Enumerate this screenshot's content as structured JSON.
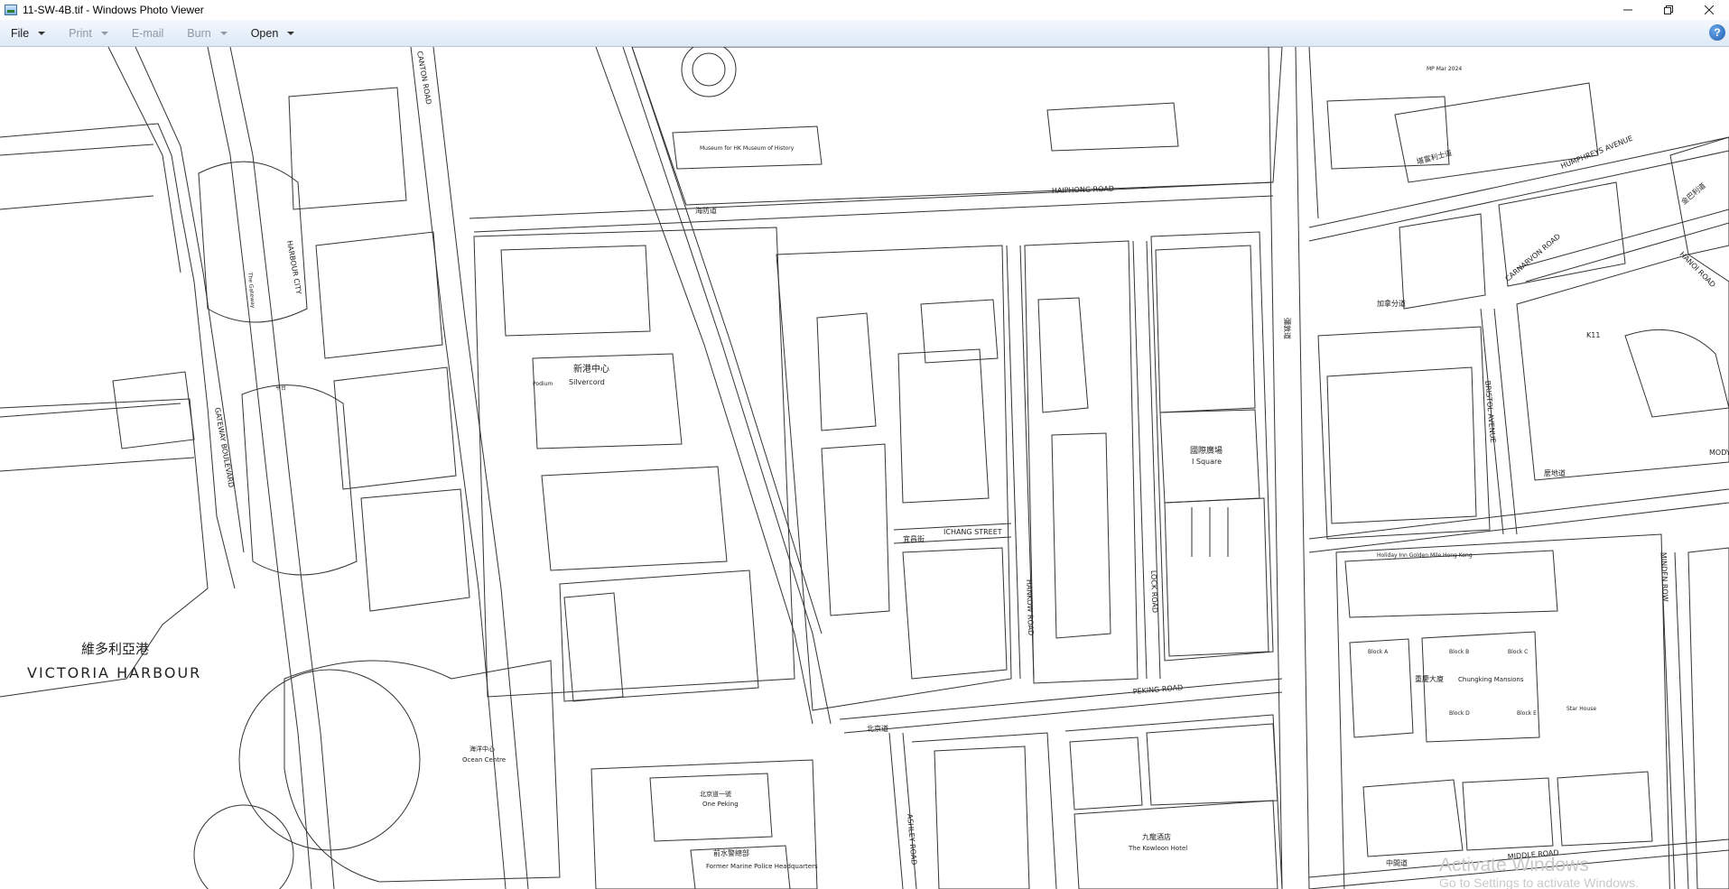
{
  "window": {
    "title": "11-SW-4B.tif - Windows Photo Viewer"
  },
  "menubar": {
    "items": [
      {
        "label": "File",
        "enabled": true,
        "has_dropdown": true
      },
      {
        "label": "Print",
        "enabled": false,
        "has_dropdown": true
      },
      {
        "label": "E-mail",
        "enabled": false,
        "has_dropdown": false
      },
      {
        "label": "Burn",
        "enabled": false,
        "has_dropdown": true
      },
      {
        "label": "Open",
        "enabled": true,
        "has_dropdown": true
      }
    ],
    "help_label": "?"
  },
  "map": {
    "harbour_zh": "維多利亞港",
    "harbour_en": "VICTORIA HARBOUR",
    "silvercord_zh": "新港中心",
    "silvercord_en": "Silvercord",
    "i_square_zh": "國際廣場",
    "i_square_en": "I Square",
    "chungking_en": "Chungking Mansions",
    "chungking_zh": "重慶大廈",
    "ocean_centre_en": "Ocean Centre",
    "ocean_centre_zh": "海洋中心",
    "one_peking_en": "One Peking",
    "one_peking_zh": "北京道一號",
    "marine_police_en": "Former Marine Police Headquarters",
    "marine_police_zh": "前水警總部",
    "harbour_city": "HARBOUR CITY",
    "gateway_boulevard": "GATEWAY BOULEVARD",
    "canton_road": "CANTON ROAD",
    "haiphong_road": "HAIPHONG ROAD",
    "haiphong_road_zh": "海防道",
    "ichang_street": "ICHANG STREET",
    "ichang_street_zh": "宜昌街",
    "peking_road": "PEKING ROAD",
    "peking_road_zh": "北京道",
    "hankow_road": "HANKOW ROAD",
    "lock_road": "LOCK ROAD",
    "ashley_road": "ASHLEY ROAD",
    "nathan_road_zh": "彌敦道",
    "middle_road": "MIDDLE ROAD",
    "middle_road_zh": "中間道",
    "humphreys_avenue": "HUMPHREYS AVENUE",
    "carnarvon_road": "CARNARVON ROAD",
    "carnarvon_road_zh": "加拿分道",
    "hanoi_road": "HANOI ROAD",
    "bristol_avenue": "BRISTOL AVENUE",
    "kimberley_road_zh": "金巴利道",
    "hillwood_zh": "堪富利士道",
    "mody_road": "MODY",
    "mody_road_zh": "麼地道",
    "minden_row": "MINDEN ROW",
    "k11": "K11",
    "holiday_inn": "Holiday Inn Golden Mile Hong Kong",
    "kowloon_hotel": "The Kowloon Hotel",
    "kowloon_hotel_zh": "九龍酒店",
    "hk_museum_history": "Museum for HK Museum of History",
    "podium": "Podium",
    "podium_zh": "平台",
    "mp_note": "MP Mar 2024",
    "block_a": "Block A",
    "block_b": "Block B",
    "block_c": "Block C",
    "block_d": "Block D",
    "block_e": "Block E",
    "star_house": "Star House",
    "gateway": "The Gateway"
  },
  "watermark": {
    "line1": "Activate Windows",
    "line2": "Go to Settings to activate Windows."
  }
}
